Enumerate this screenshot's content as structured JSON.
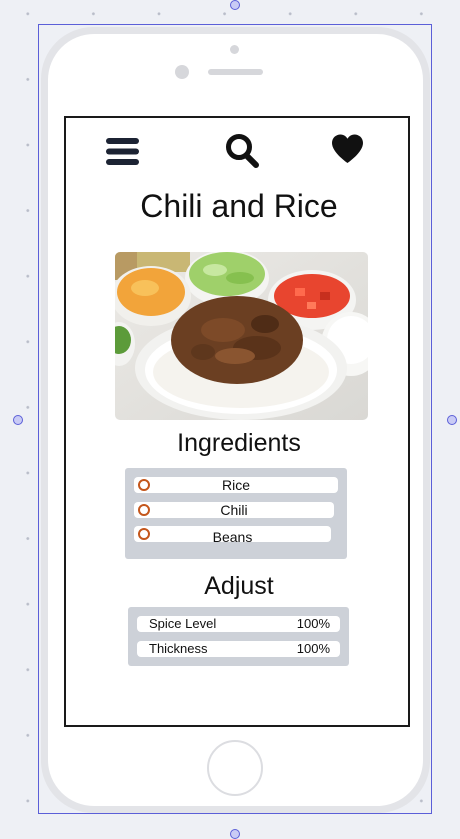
{
  "header": {
    "menu_icon": "hamburger-menu-icon",
    "search_icon": "search-icon",
    "favorite_icon": "heart-icon"
  },
  "recipe": {
    "title": "Chili and Rice",
    "image_alt": "Bowl of chili over white rice with toppings"
  },
  "ingredients": {
    "heading": "Ingredients",
    "items": [
      {
        "label": "Rice"
      },
      {
        "label": "Chili"
      },
      {
        "label": "Beans"
      }
    ]
  },
  "adjust": {
    "heading": "Adjust",
    "rows": [
      {
        "label": "Spice Level",
        "value": "100%"
      },
      {
        "label": "Thickness",
        "value": "100%"
      }
    ]
  },
  "colors": {
    "radio_accent": "#c4561b",
    "panel_bg": "#cdd1d8",
    "selection": "#5b5fd8"
  }
}
